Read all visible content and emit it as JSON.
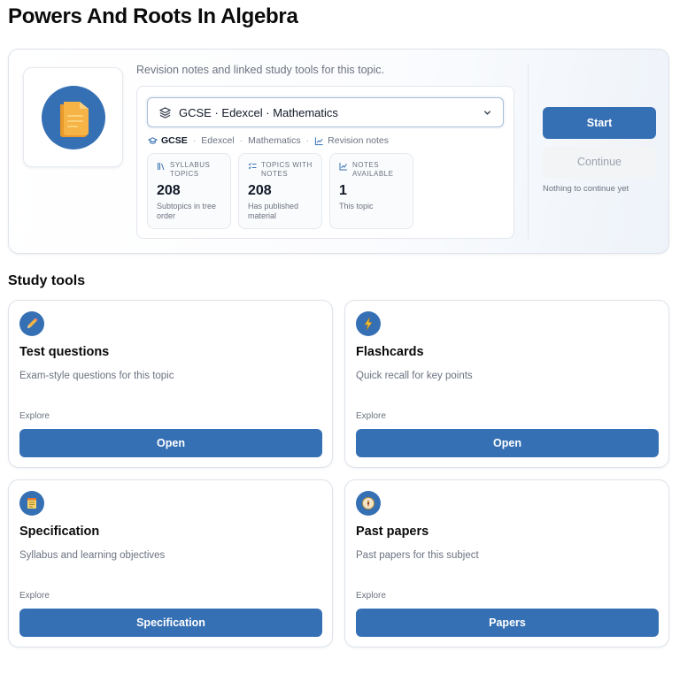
{
  "page": {
    "title": "Powers And Roots In Algebra"
  },
  "hero": {
    "description": "Revision notes and linked study tools for this topic.",
    "image_icon": "folder-notes-icon",
    "select": {
      "value": "GCSE · Edexcel · Mathematics",
      "icon": "layers-icon"
    },
    "breadcrumb": {
      "level": "GCSE",
      "board": "Edexcel",
      "subject": "Mathematics",
      "page": "Revision notes"
    },
    "stats": [
      {
        "label": "Syllabus topics",
        "value": "208",
        "sub": "Subtopics in tree order",
        "icon": "books-icon"
      },
      {
        "label": "Topics with notes",
        "value": "208",
        "sub": "Has published material",
        "icon": "checklist-icon"
      },
      {
        "label": "Notes available",
        "value": "1",
        "sub": "This topic",
        "icon": "chart-icon"
      }
    ],
    "start_label": "Start",
    "continue_label": "Continue",
    "continue_note": "Nothing to continue yet"
  },
  "study_tools": {
    "title": "Study tools",
    "cards": [
      {
        "title": "Test questions",
        "desc": "Exam-style questions for this topic",
        "explore": "Explore",
        "button": "Open",
        "icon": "pencil-icon"
      },
      {
        "title": "Flashcards",
        "desc": "Quick recall for key points",
        "explore": "Explore",
        "button": "Open",
        "icon": "lightning-icon"
      },
      {
        "title": "Specification",
        "desc": "Syllabus and learning objectives",
        "explore": "Explore",
        "button": "Specification",
        "icon": "notepad-icon"
      },
      {
        "title": "Past papers",
        "desc": "Past papers for this subject",
        "explore": "Explore",
        "button": "Papers",
        "icon": "compass-icon"
      }
    ]
  },
  "colors": {
    "accent": "#3670b4",
    "muted_text": "#6b7280",
    "border": "#dde3ea"
  }
}
